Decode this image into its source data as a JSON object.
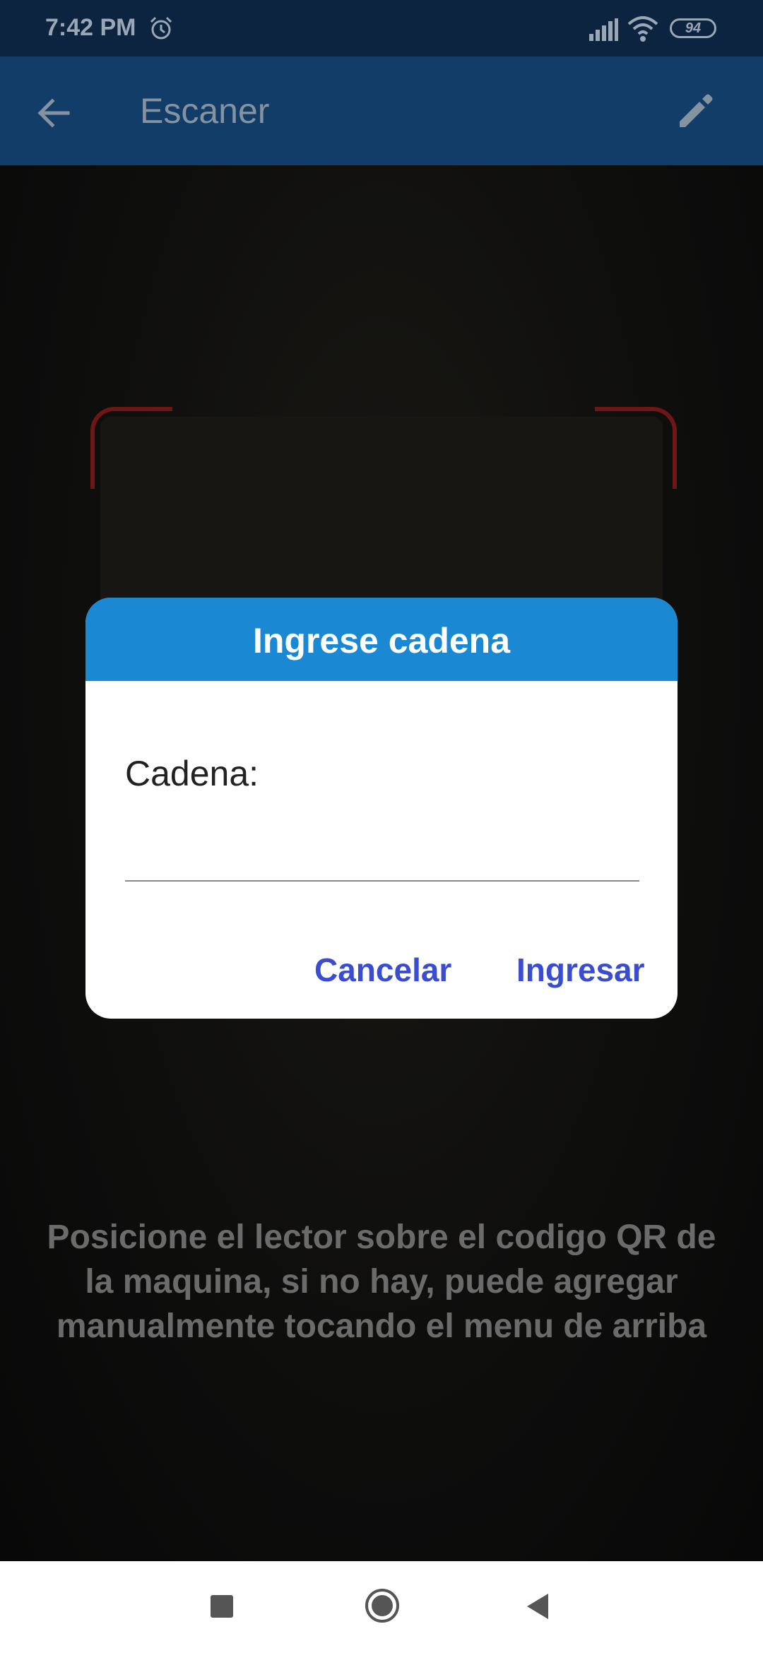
{
  "status_bar": {
    "time": "7:42 PM",
    "alarm_icon": "alarm-clock-icon",
    "signal_icon": "cell-signal-icon",
    "wifi_icon": "wifi-icon",
    "battery_level": "94"
  },
  "app_bar": {
    "back_icon": "arrow-back-icon",
    "title": "Escaner",
    "edit_icon": "pencil-edit-icon"
  },
  "scanner": {
    "hint": "Posicione el lector sobre el codigo QR de la maquina, si no hay, puede agregar manualmente tocando el menu de arriba"
  },
  "dialog": {
    "title": "Ingrese cadena",
    "field_label": "Cadena:",
    "field_value": "",
    "cancel_label": "Cancelar",
    "submit_label": "Ingresar"
  },
  "nav_bar": {
    "recents_icon": "square-recents-icon",
    "home_icon": "circle-home-icon",
    "back_icon": "triangle-back-icon"
  },
  "colors": {
    "status_bar": "#0c2440",
    "app_bar": "#113d68",
    "dialog_header": "#1a88d3",
    "dialog_button": "#3a4dd0",
    "scan_frame": "#6e1616"
  }
}
